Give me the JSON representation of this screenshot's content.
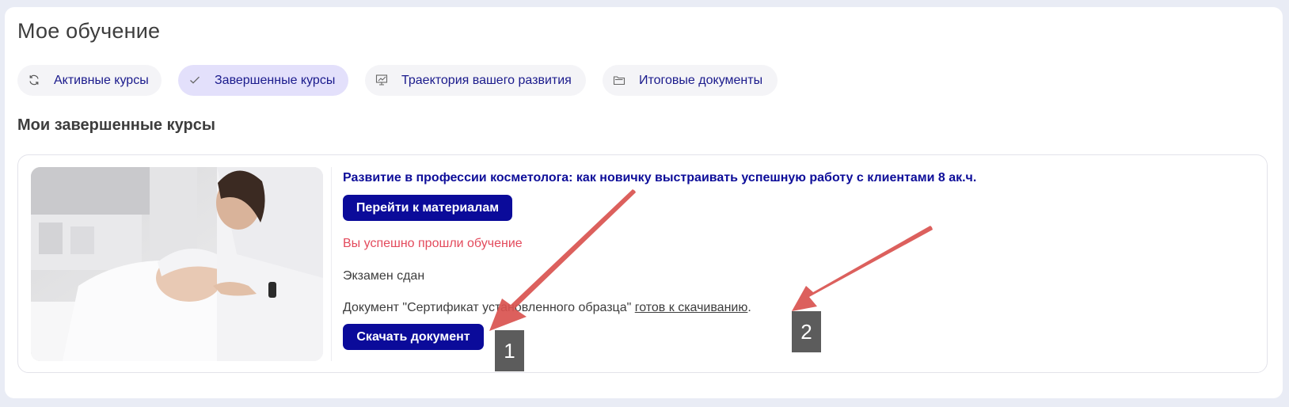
{
  "page": {
    "title": "Мое обучение",
    "section_title": "Мои завершенные курсы"
  },
  "tabs": [
    {
      "label": "Активные курсы",
      "icon": "refresh-icon",
      "active": false
    },
    {
      "label": "Завершенные курсы",
      "icon": "check-icon",
      "active": true
    },
    {
      "label": "Траектория вашего развития",
      "icon": "chart-board-icon",
      "active": false
    },
    {
      "label": "Итоговые документы",
      "icon": "folder-icon",
      "active": false
    }
  ],
  "course": {
    "title": "Развитие в профессии косметолога: как новичку выстраивать успешную работу с клиентами 8 ак.ч.",
    "materials_button": "Перейти к материалам",
    "success_text": "Вы успешно прошли обучение",
    "exam_text": "Экзамен сдан",
    "doc_prefix": "Документ \"Сертификат установленного образца\" ",
    "doc_link": "готов к скачиванию",
    "doc_suffix": ".",
    "download_button": "Скачать документ",
    "image": "cosmetologist-facial-treatment-photo"
  },
  "annotations": [
    {
      "label": "1"
    },
    {
      "label": "2"
    }
  ],
  "colors": {
    "accent": "#0b0b9a",
    "tab_text": "#1a1a8c",
    "active_tab_bg": "#e3e0fb",
    "success": "#e34a5c",
    "arrow": "#d9534f",
    "badge": "#5c5c5c"
  }
}
